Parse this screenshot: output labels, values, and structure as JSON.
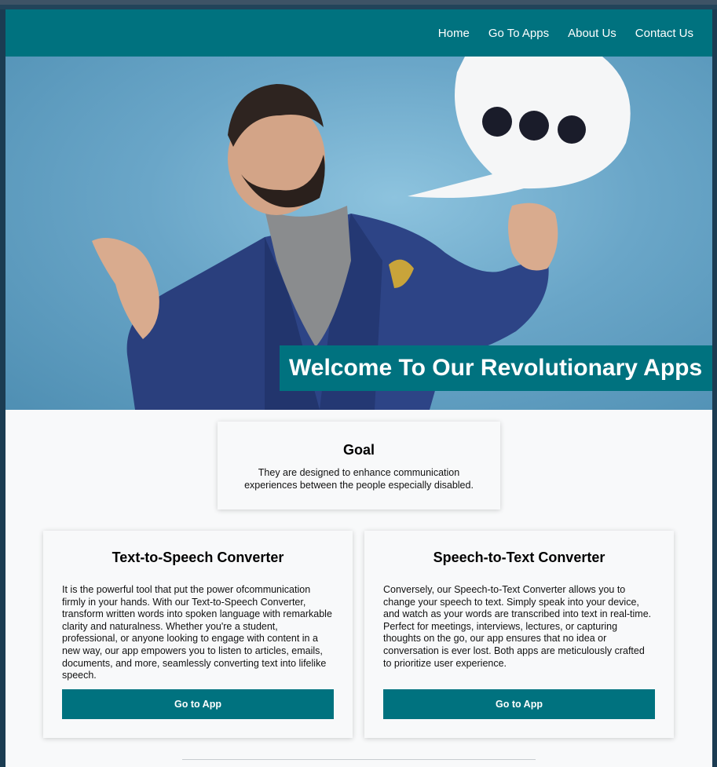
{
  "nav": {
    "links": [
      "Home",
      "Go To Apps",
      "About Us",
      "Contact Us"
    ]
  },
  "hero": {
    "title": "Welcome To Our Revolutionary Apps",
    "image": "man-with-speech-bubble-photo"
  },
  "goal": {
    "heading": "Goal",
    "text": "They are designed to enhance communication experiences between the people especially disabled."
  },
  "apps": [
    {
      "heading": "Text-to-Speech Converter",
      "text": "It is the powerful tool that put the power ofcommunication firmly in your hands. With our Text-to-Speech Converter, transform written words into spoken language with remarkable clarity and naturalness. Whether you're a student, professional, or anyone looking to engage with content in a new way, our app empowers you to listen to articles, emails, documents, and more, seamlessly converting text into lifelike speech.",
      "button": "Go to App"
    },
    {
      "heading": "Speech-to-Text Converter",
      "text": "Conversely, our Speech-to-Text Converter allows you to change your speech to text. Simply speak into your device, and watch as your words are transcribed into text in real-time. Perfect for meetings, interviews, lectures, or capturing thoughts on the go, our app ensures that no idea or conversation is ever lost. Both apps are meticulously crafted to prioritize user experience.",
      "button": "Go to App"
    }
  ],
  "colors": {
    "primary": "#00727f",
    "background": "#f8f9fa",
    "outer": "#1b3c52"
  }
}
